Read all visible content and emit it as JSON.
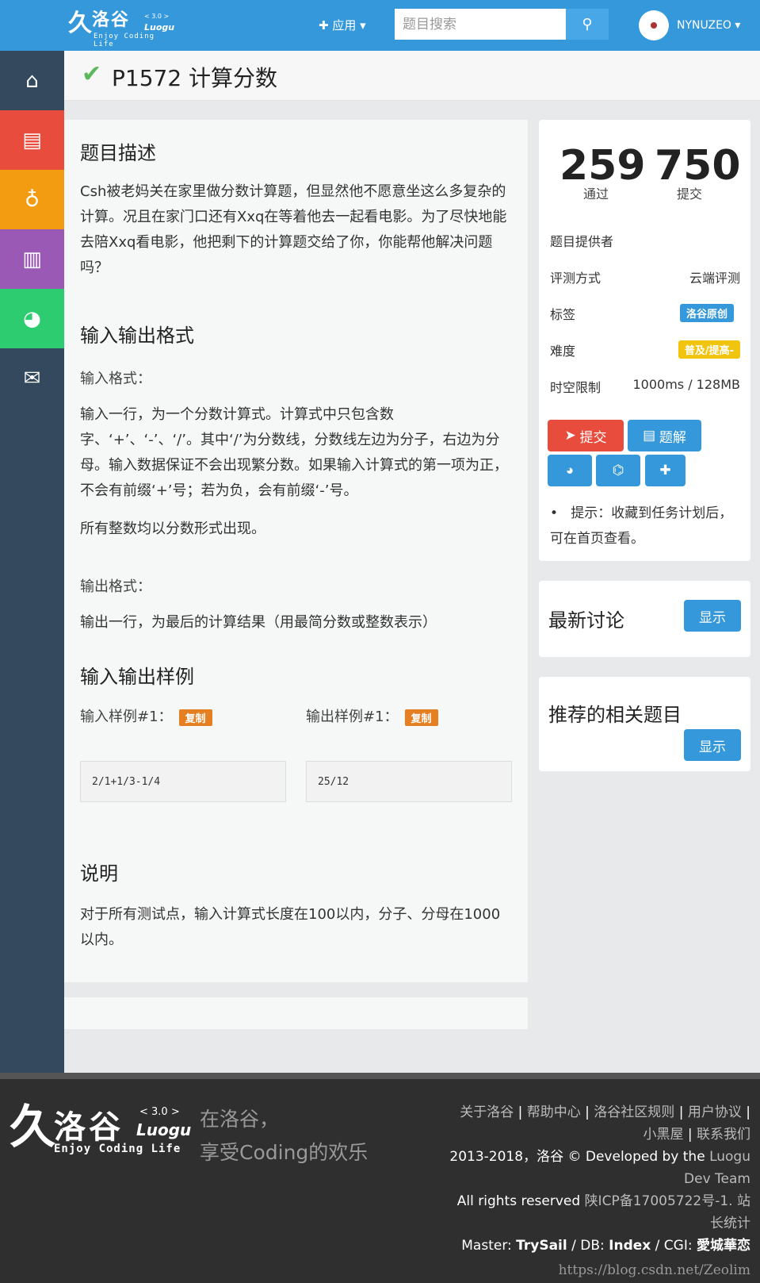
{
  "header": {
    "logo_mark": "久",
    "logo_cn": "洛谷",
    "logo_version": "< 3.0 >",
    "logo_luogu": "Luogu",
    "logo_sub": "Enjoy Coding Life",
    "apps_label": "应用",
    "search_placeholder": "题目搜索",
    "username": "NYNUZEO"
  },
  "problem": {
    "title": "P1572 计算分数",
    "desc_title": "题目描述",
    "desc_text": "Csh被老妈关在家里做分数计算题，但显然他不愿意坐这么多复杂的计算。况且在家门口还有Xxq在等着他去一起看电影。为了尽快地能去陪Xxq看电影，他把剩下的计算题交给了你，你能帮他解决问题吗？",
    "io_title": "输入输出格式",
    "input_label": "输入格式：",
    "input_text": "输入一行，为一个分数计算式。计算式中只包含数字、‘+’、‘-’、‘/’。其中‘/’为分数线，分数线左边为分子，右边为分母。输入数据保证不会出现繁分数。如果输入计算式的第一项为正，不会有前缀‘+’号；若为负，会有前缀‘-’号。",
    "input_text2": "所有整数均以分数形式出现。",
    "output_label": "输出格式：",
    "output_text": "输出一行，为最后的计算结果（用最简分数或整数表示）",
    "sample_title": "输入输出样例",
    "sample_in_label": "输入样例#1：",
    "sample_out_label": "输出样例#1：",
    "copy_label": "复制",
    "sample_in": "2/1+1/3-1/4",
    "sample_out": "25/12",
    "note_title": "说明",
    "note_text": "对于所有测试点，输入计算式长度在100以内，分子、分母在1000以内。"
  },
  "info": {
    "pass_count": "259",
    "pass_label": "通过",
    "submit_count": "750",
    "submit_label": "提交",
    "provider_label": "题目提供者",
    "judge_label": "评测方式",
    "judge_value": "云端评测",
    "tag_label": "标签",
    "tag_value": "洛谷原创",
    "difficulty_label": "难度",
    "difficulty_value": "普及/提高-",
    "limit_label": "时空限制",
    "limit_value": "1000ms / 128MB",
    "submit_btn": "提交",
    "solution_btn": "题解",
    "tip": "提示：收藏到任务计划后，可在首页查看。"
  },
  "discussion": {
    "title": "最新讨论",
    "show_btn": "显示"
  },
  "related": {
    "title": "推荐的相关题目",
    "show_btn": "显示"
  },
  "footer": {
    "slogan1": "在洛谷，",
    "slogan2": "享受Coding的欢乐",
    "link1": "关于洛谷",
    "link2": "帮助中心",
    "link3": "洛谷社区规则",
    "link4": "用户协议",
    "link5": "小黑屋",
    "link6": "联系我们",
    "copyright": "2013-2018，洛谷 © Developed by the",
    "team": "Luogu Dev Team",
    "rights": "All rights reserved",
    "icp": "陕ICP备17005722号-1.",
    "stats": "站长统计",
    "master_label": "Master:",
    "master": "TrySail",
    "db_label": "DB:",
    "db": "Index",
    "cgi_label": "CGI:",
    "cgi": "愛城華恋",
    "watermark": "https://blog.csdn.net/Zeolim"
  },
  "colors": {
    "header": "#3498db",
    "sidebar": "#34495e",
    "red": "#e74c3c",
    "orange": "#e67e22",
    "yellow": "#f1c40f"
  }
}
